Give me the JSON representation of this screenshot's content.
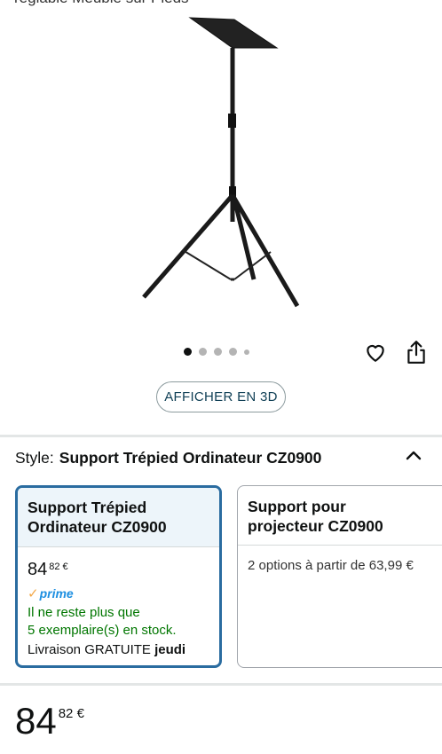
{
  "header": {
    "title_fragment": "réglable Meuble sur Pieds"
  },
  "gallery": {
    "image_alt": "Support trépied ordinateur",
    "image_count": 5,
    "active_index": 0
  },
  "actions": {
    "view_3d_label": "AFFICHER EN 3D"
  },
  "style": {
    "label": "Style:",
    "value": "Support Trépied Ordinateur CZ0900"
  },
  "options": [
    {
      "title_line1": "Support Trépied",
      "title_line2": "Ordinateur CZ0900",
      "price_whole": "84",
      "price_fraction": "82 €",
      "prime_label": "prime",
      "stock_line1": "Il ne reste plus que",
      "stock_line2": "5 exemplaire(s) en stock.",
      "delivery_prefix": "Livraison GRATUITE",
      "delivery_day": "jeudi",
      "selected": true
    },
    {
      "title_line1": "Support pour",
      "title_line2": "projecteur CZ0900",
      "options_text": "2 options à partir de 63,99 €",
      "selected": false
    }
  ],
  "price": {
    "whole": "84",
    "fraction": "82 €"
  },
  "colors": {
    "selected_border": "#2a6ca0",
    "selected_bg": "#edf5fa",
    "stock_green": "#007600",
    "prime_blue": "#1d8fe1",
    "prime_check": "#f3a847"
  }
}
